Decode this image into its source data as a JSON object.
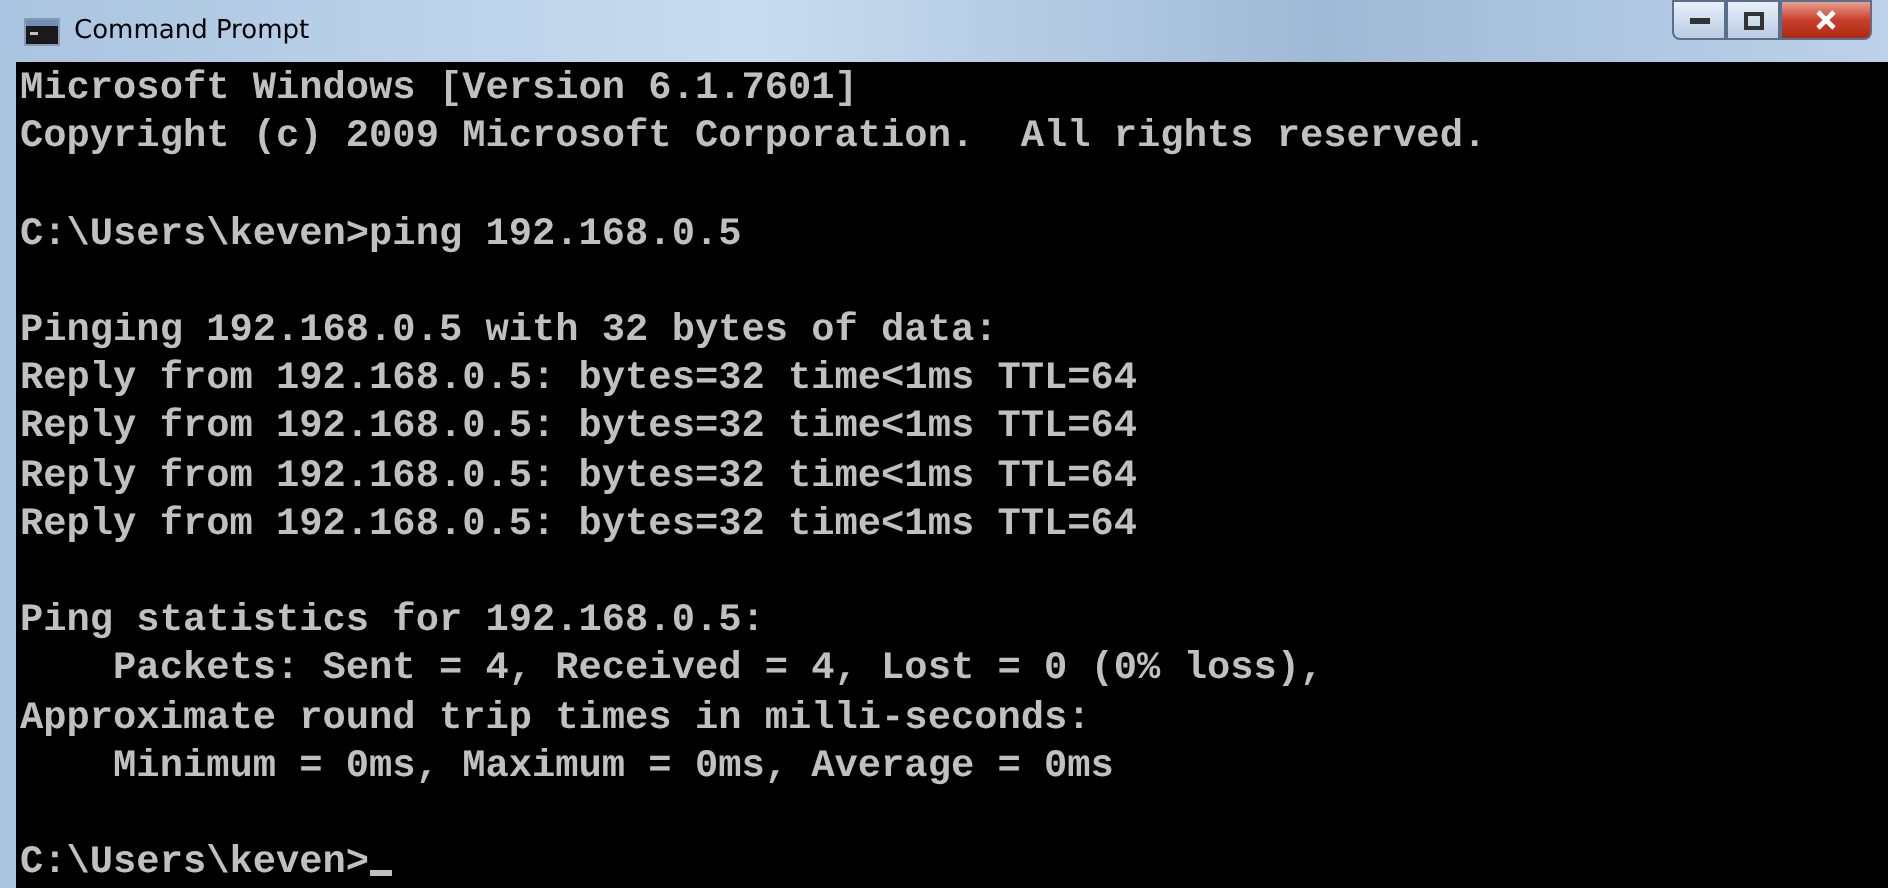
{
  "window": {
    "title": "Command Prompt"
  },
  "console": {
    "blocks": [
      [
        "Microsoft Windows [Version 6.1.7601]",
        "Copyright (c) 2009 Microsoft Corporation.  All rights reserved."
      ],
      [
        "C:\\Users\\keven>ping 192.168.0.5"
      ],
      [
        "Pinging 192.168.0.5 with 32 bytes of data:",
        "Reply from 192.168.0.5: bytes=32 time<1ms TTL=64",
        "Reply from 192.168.0.5: bytes=32 time<1ms TTL=64",
        "Reply from 192.168.0.5: bytes=32 time<1ms TTL=64",
        "Reply from 192.168.0.5: bytes=32 time<1ms TTL=64"
      ],
      [
        "Ping statistics for 192.168.0.5:",
        "    Packets: Sent = 4, Received = 4, Lost = 0 (0% loss),",
        "Approximate round trip times in milli-seconds:",
        "    Minimum = 0ms, Maximum = 0ms, Average = 0ms"
      ]
    ],
    "prompt": "C:\\Users\\keven>"
  }
}
